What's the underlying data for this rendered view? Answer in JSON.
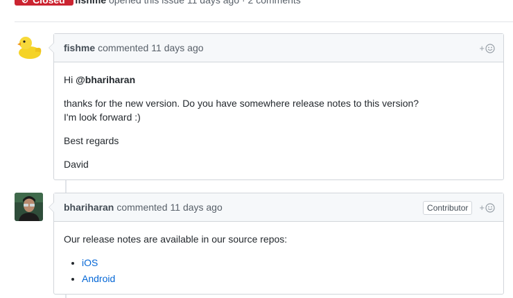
{
  "issue": {
    "status": "Closed",
    "author": "fishme",
    "meta_text": "opened this issue 11 days ago · 2 comments"
  },
  "comments": [
    {
      "author": "fishme",
      "verb": "commented",
      "time": "11 days ago",
      "greeting_prefix": "Hi",
      "mention": "@bhariharan",
      "line1": "thanks for the new version. Do you have somewhere release notes to this version?",
      "line2": "I'm look forward :)",
      "closing": "Best regards",
      "signature": "David",
      "reaction_plus": "+"
    },
    {
      "author": "bhariharan",
      "verb": "commented",
      "time": "11 days ago",
      "badge": "Contributor",
      "intro": "Our release notes are available in our source repos:",
      "links": [
        "iOS",
        "Android"
      ],
      "reaction_plus": "+"
    }
  ],
  "colors": {
    "closed": "#cb2431",
    "link": "#0366d6",
    "duck": "#f5d327"
  }
}
